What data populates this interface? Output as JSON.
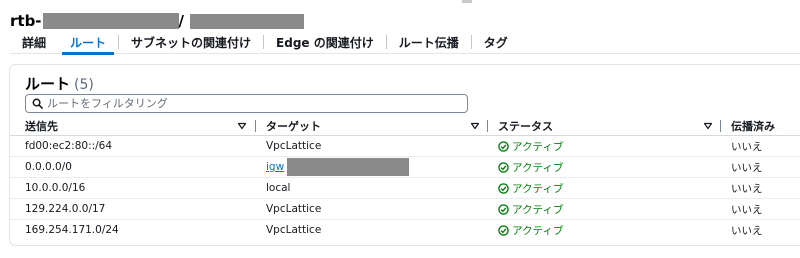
{
  "header": {
    "title_prefix": "rtb-",
    "title_sep": "/"
  },
  "tabs": [
    {
      "label": "詳細",
      "active": false
    },
    {
      "label": "ルート",
      "active": true
    },
    {
      "label": "サブネットの関連付け",
      "active": false
    },
    {
      "label": "Edge の関連付け",
      "active": false
    },
    {
      "label": "ルート伝播",
      "active": false
    },
    {
      "label": "タグ",
      "active": false
    }
  ],
  "routes": {
    "title": "ルート",
    "count": "(5)",
    "search_placeholder": "ルートをフィルタリング",
    "columns": [
      "送信先",
      "ターゲット",
      "ステータス",
      "伝播済み"
    ],
    "rows": [
      {
        "destination": "fd00:ec2:80::/64",
        "target": "VpcLattice",
        "target_is_link": false,
        "status": "アクティブ",
        "propagated": "いいえ"
      },
      {
        "destination": "0.0.0.0/0",
        "target": "igw",
        "target_is_link": true,
        "status": "アクティブ",
        "propagated": "いいえ"
      },
      {
        "destination": "10.0.0.0/16",
        "target": "local",
        "target_is_link": false,
        "status": "アクティブ",
        "propagated": "いいえ"
      },
      {
        "destination": "129.224.0.0/17",
        "target": "VpcLattice",
        "target_is_link": false,
        "status": "アクティブ",
        "propagated": "いいえ"
      },
      {
        "destination": "169.254.171.0/24",
        "target": "VpcLattice",
        "target_is_link": false,
        "status": "アクティブ",
        "propagated": "いいえ"
      }
    ]
  },
  "colors": {
    "accent": "#0972d3",
    "success": "#037f0c",
    "text": "#16191f",
    "muted": "#5f6b7a"
  },
  "icons": {
    "search": "search-icon",
    "sort": "sort-down-icon",
    "status": "check-circle-icon"
  }
}
